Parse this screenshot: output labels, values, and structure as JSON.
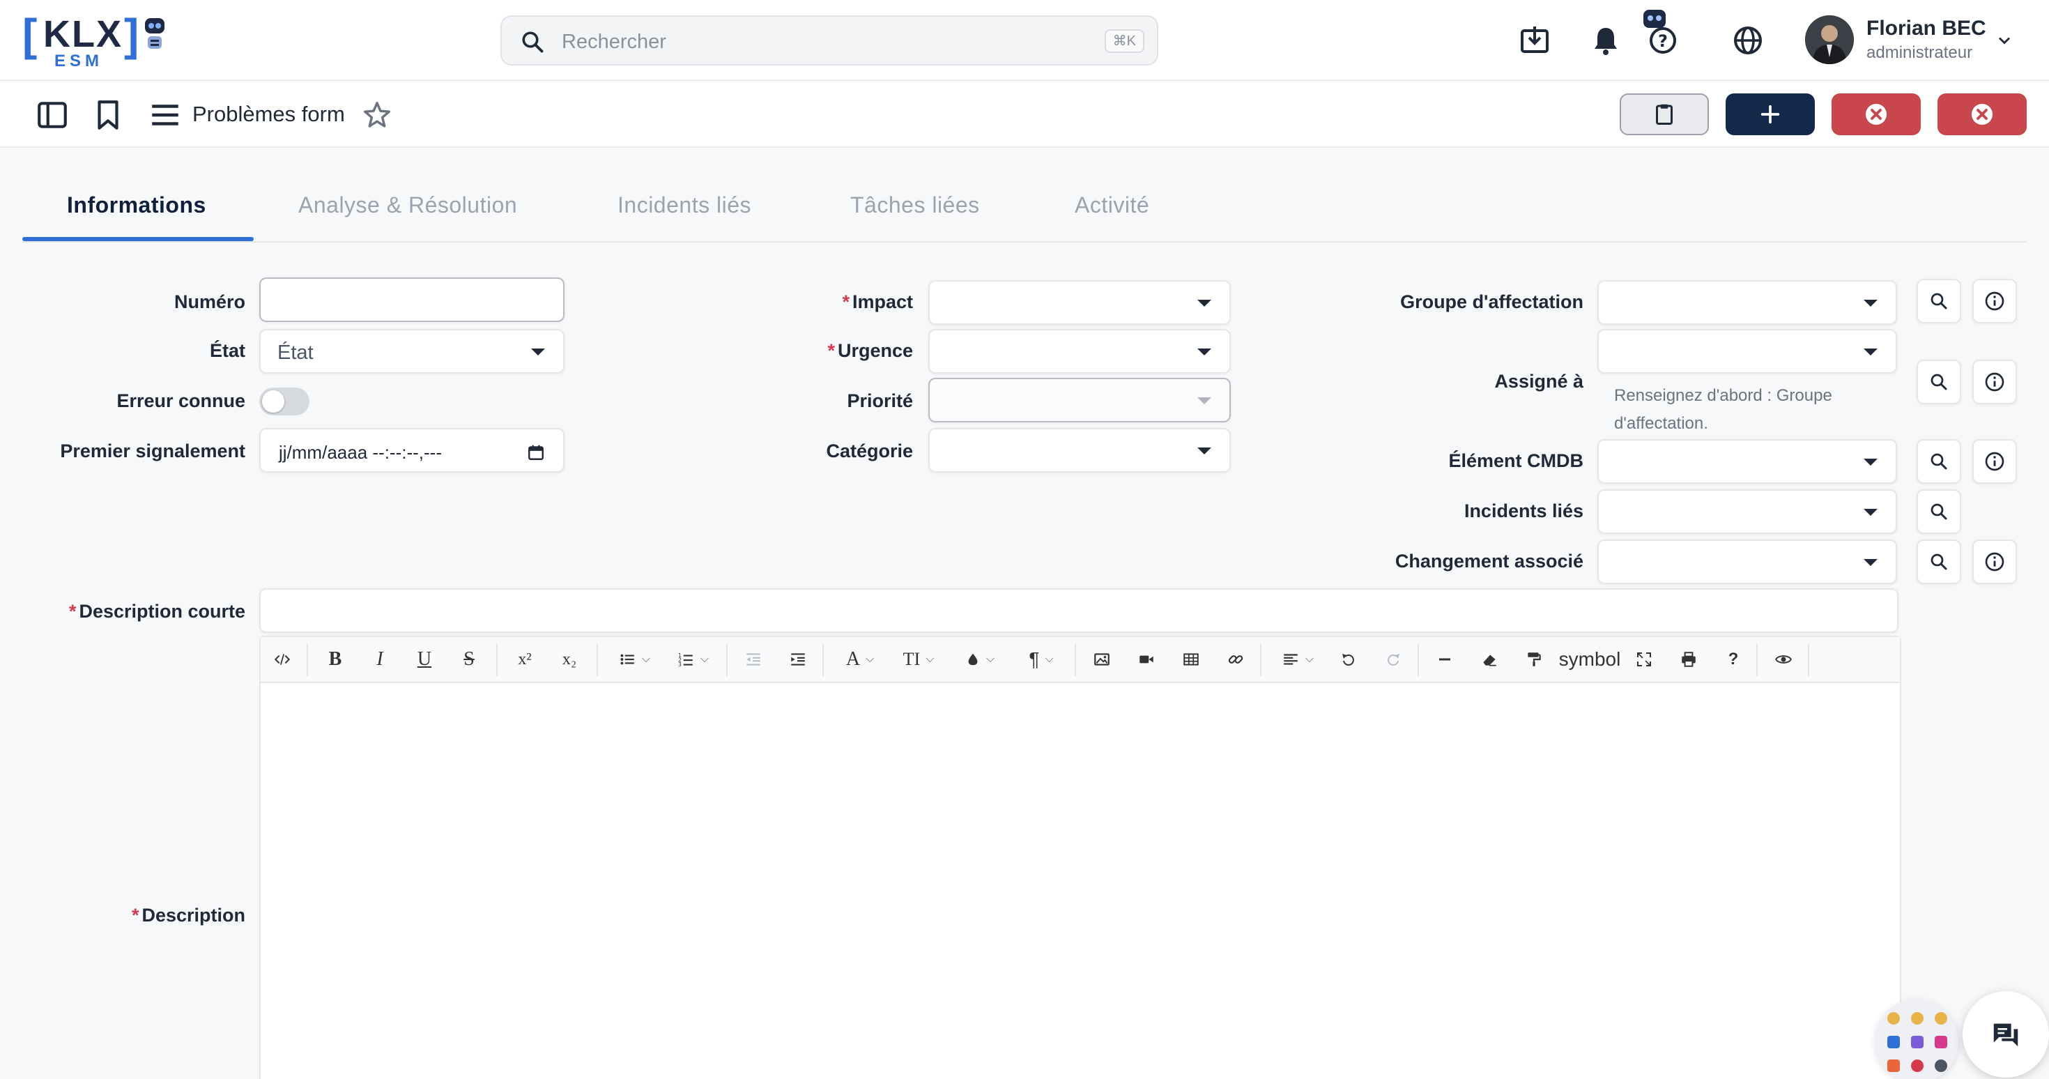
{
  "brand": {
    "bracket_left": "[",
    "name": "KLX",
    "bracket_right": "]",
    "sub": "ESM"
  },
  "search": {
    "placeholder": "Rechercher",
    "shortcut": "⌘K"
  },
  "user": {
    "name": "Florian BEC",
    "role": "administrateur"
  },
  "header": {
    "form_title": "Problèmes form"
  },
  "tabs": [
    {
      "label": "Informations",
      "active": true
    },
    {
      "label": "Analyse & Résolution"
    },
    {
      "label": "Incidents liés"
    },
    {
      "label": "Tâches liées"
    },
    {
      "label": "Activité"
    }
  ],
  "form": {
    "numero": {
      "label": "Numéro",
      "value": ""
    },
    "etat": {
      "label": "État",
      "placeholder": "État"
    },
    "erreur_connue": {
      "label": "Erreur connue",
      "value": false
    },
    "premier_signalement": {
      "label": "Premier signalement",
      "placeholder": "jj/mm/aaaa --:--:--,---"
    },
    "impact": {
      "label": "Impact",
      "required": "*"
    },
    "urgence": {
      "label": "Urgence",
      "required": "*"
    },
    "priorite": {
      "label": "Priorité"
    },
    "categorie": {
      "label": "Catégorie"
    },
    "groupe": {
      "label": "Groupe d'affectation"
    },
    "assigne": {
      "label": "Assigné à",
      "hint": "Renseignez d'abord : Groupe d'affectation."
    },
    "cmdb": {
      "label": "Élément CMDB"
    },
    "incidents_lies": {
      "label": "Incidents liés"
    },
    "changement": {
      "label": "Changement associé"
    },
    "description_courte": {
      "label": "Description courte",
      "required": "*"
    },
    "description": {
      "label": "Description",
      "required": "*"
    }
  },
  "editor": {
    "symbol_label": "symbol",
    "text_style_label": "TI",
    "font_label": "A",
    "paragraph_label": "¶",
    "help_label": "?"
  },
  "colors": {
    "primary": "#14294a",
    "accent": "#2f6fd6",
    "danger": "#c9474c",
    "required": "#d6394a"
  }
}
